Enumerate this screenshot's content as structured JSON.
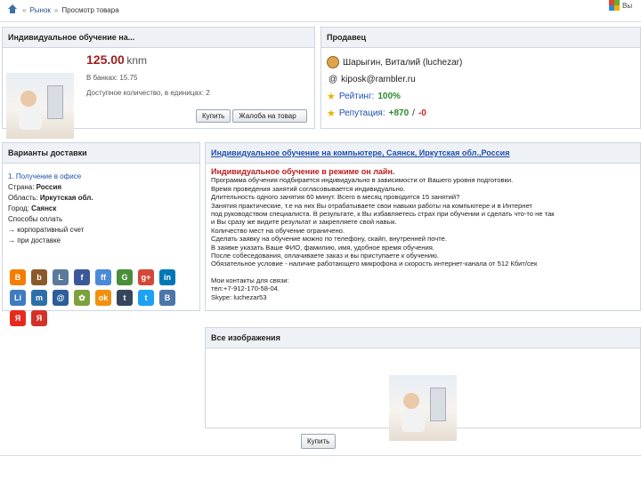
{
  "breadcrumb": {
    "home_icon": "home-icon",
    "link": "Рынок",
    "sep": "»",
    "current": "Просмотр товара"
  },
  "topright": {
    "text": "Вы"
  },
  "product": {
    "title": "Индивидуальное обучение на...",
    "price": "125.00",
    "currency": "knm",
    "in_bank_label": "В банках:",
    "in_bank_value": "15.75",
    "qty_label": "Доступное количество, в единицах:",
    "qty_value": "2",
    "buy_label": "Купить",
    "complain_label": "Жалоба на товар"
  },
  "seller": {
    "header": "Продавец",
    "name": "Шарыгин, Виталий (luchezar)",
    "email": "kiposk@rambler.ru",
    "rating_label": "Рейтинг:",
    "rating_value": "100%",
    "rep_label": "Репутация:",
    "rep_pos": "+870",
    "rep_slash": "/",
    "rep_neg": "-0"
  },
  "delivery": {
    "header": "Варианты доставки",
    "option": "1. Получение в офисе",
    "country_label": "Страна:",
    "country": "Россия",
    "region_label": "Область:",
    "region": "Иркутская обл.",
    "city_label": "Город:",
    "city": "Саянск",
    "pay_label": "Способы оплать",
    "pay1": "→ корпоративный счет",
    "pay2": "→ при доставке"
  },
  "social": [
    {
      "icon": "blogger-icon",
      "color": "#f57d00",
      "t": "B"
    },
    {
      "icon": "bobrdobr-icon",
      "color": "#8b5a2b",
      "t": "b"
    },
    {
      "icon": "livejournal-icon",
      "color": "#5a7a9a",
      "t": "L"
    },
    {
      "icon": "facebook-icon",
      "color": "#3b5998",
      "t": "f"
    },
    {
      "icon": "friendfeed-icon",
      "color": "#4b8ad8",
      "t": "ff"
    },
    {
      "icon": "google-icon",
      "color": "#4a8e3a",
      "t": "G"
    },
    {
      "icon": "googleplus-icon",
      "color": "#d34836",
      "t": "g+"
    },
    {
      "icon": "linkedin-icon",
      "color": "#0077b5",
      "t": "in"
    },
    {
      "icon": "liveinternet-icon",
      "color": "#3f7cc0",
      "t": "Li"
    },
    {
      "icon": "memori-icon",
      "color": "#2d6fa8",
      "t": "m"
    },
    {
      "icon": "mailru-icon",
      "color": "#2a5d9a",
      "t": "@"
    },
    {
      "icon": "moikrug-icon",
      "color": "#7da13b",
      "t": "✿"
    },
    {
      "icon": "odnoklassniki-icon",
      "color": "#f2910d",
      "t": "ok"
    },
    {
      "icon": "tumblr-icon",
      "color": "#35465c",
      "t": "t"
    },
    {
      "icon": "twitter-icon",
      "color": "#1da1f2",
      "t": "t"
    },
    {
      "icon": "vkontakte-icon",
      "color": "#4a76a8",
      "t": "B"
    },
    {
      "icon": "yandex-icon",
      "color": "#e62b1e",
      "t": "Я"
    },
    {
      "icon": "yaru-icon",
      "color": "#d4302a",
      "t": "Я"
    }
  ],
  "description": {
    "header": "Индивидуальное обучение на компьютере, Саянск, Иркутская обл.,Россия",
    "lead": "Индивидуальное обучение в режиме он лайн.",
    "lines": [
      "Программа обучения подбирается индивидуально в зависимости от Вашего уровня подготовки.",
      "Время проведения занятий согласовывается индивидуально.",
      "Длительность одного занятия 60 минут. Всего в месяц проводится 15 занятий?",
      "Занятия практические, т.е на них Вы отрабатываете свои навыки работы на компьютере и в Интернет",
      "под руководством специалиста. В результате, к Вы избавляетесь страх при обучении и сделать что-то не так",
      "и Вы сразу же видите результат и закрепляете свой навык.",
      "Количество мест на обучение ограничено.",
      "Сделать заявку на обучение можно по телефону, скайп, внутренней почте.",
      "В заявке указать Ваше ФИО, фамилию, имя, удобное время обучения.",
      "После собеседования, оплачиваете заказ и вы приступаете к обучению.",
      "Обязательное условие - наличие работающего микрофона и скорость интернет-канала от 512 Кбит/сек",
      "",
      "Мои контакты для связи:",
      "тел:+7-912-170-58-04.",
      "Skype: luchezar53"
    ]
  },
  "images": {
    "header": "Все изображения"
  },
  "bottom_buy": "Купить"
}
